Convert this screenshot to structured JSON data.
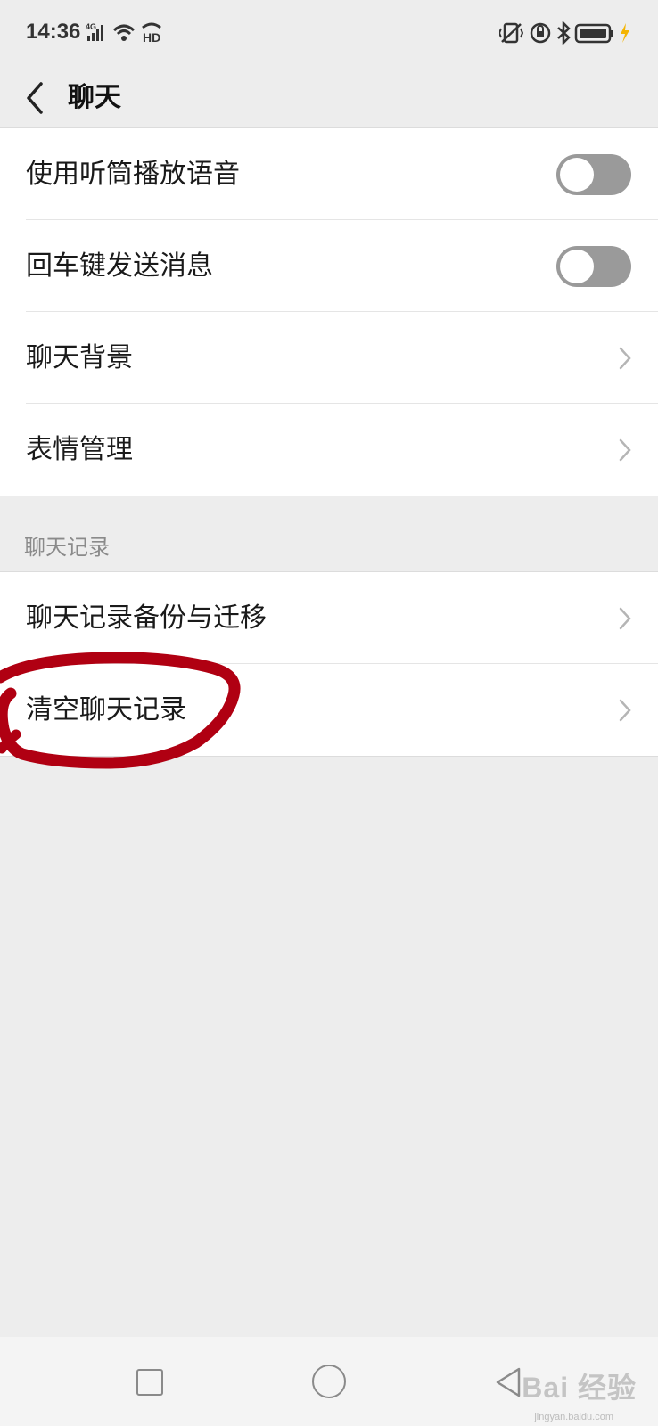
{
  "status_bar": {
    "time": "14:36",
    "signal_label": "4G",
    "hd_label": "HD",
    "icons_left": [
      "signal-icon",
      "wifi-icon",
      "hd-call-icon"
    ],
    "icons_right": [
      "vibrate-icon",
      "rotation-lock-icon",
      "bluetooth-icon",
      "battery-icon",
      "charging-icon"
    ]
  },
  "nav": {
    "title": "聊天",
    "back_icon": "chevron-left-icon"
  },
  "settings": {
    "rows": [
      {
        "label": "使用听筒播放语音",
        "control": "toggle",
        "on": false
      },
      {
        "label": "回车键发送消息",
        "control": "toggle",
        "on": false
      },
      {
        "label": "聊天背景",
        "control": "chevron"
      },
      {
        "label": "表情管理",
        "control": "chevron"
      }
    ]
  },
  "chat_history": {
    "header": "聊天记录",
    "rows": [
      {
        "label": "聊天记录备份与迁移",
        "control": "chevron"
      },
      {
        "label": "清空聊天记录",
        "control": "chevron",
        "annotated": true
      }
    ]
  },
  "annotation": {
    "color": "#b00012"
  },
  "bottom_nav": {
    "icons": [
      "recent-apps-icon",
      "home-icon",
      "back-triangle-icon"
    ]
  },
  "watermark": {
    "text": "Bai 经验",
    "sub": "jingyan.baidu.com"
  },
  "colors": {
    "background": "#ededed",
    "card": "#ffffff",
    "toggle_off": "#9a9a9a",
    "annotation": "#b00012"
  }
}
